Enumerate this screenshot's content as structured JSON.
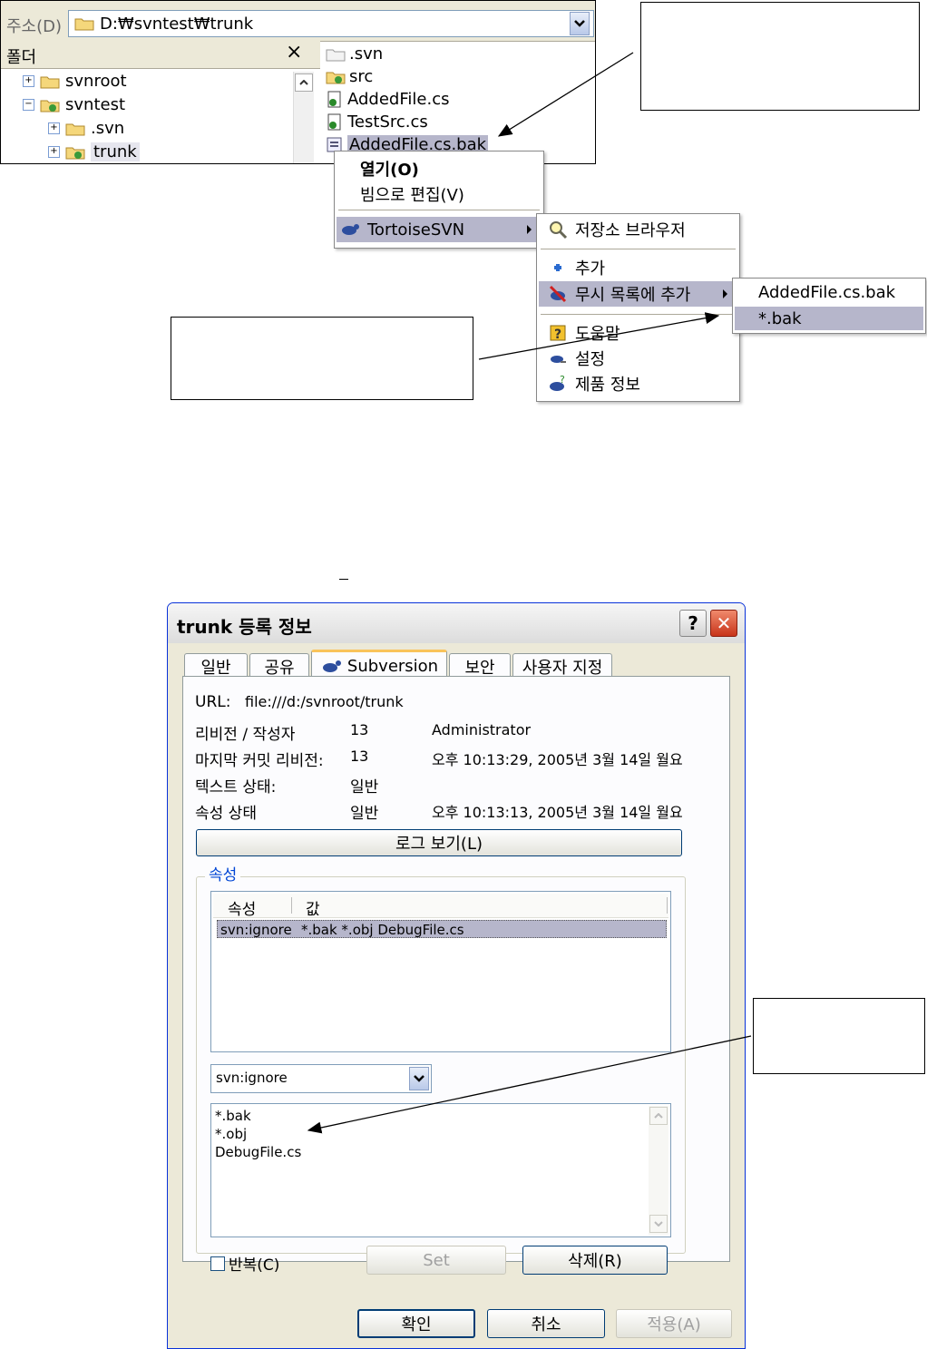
{
  "explorer": {
    "address_label": "주소(D)",
    "address_value": "D:₩svntest₩trunk",
    "folders_label": "폴더",
    "close_glyph": "×",
    "tree": [
      {
        "label": "svnroot",
        "expander": "+"
      },
      {
        "label": "svntest",
        "expander": "−"
      },
      {
        "label": ".svn",
        "expander": "+"
      },
      {
        "label": "trunk",
        "expander": "+"
      }
    ],
    "files": [
      ".svn",
      "src",
      "AddedFile.cs",
      "TestSrc.cs",
      "AddedFile.cs.bak"
    ]
  },
  "context_menu": {
    "open": "열기(O)",
    "edit_vim": "빔으로 편집(V)",
    "tortoise": "TortoiseSVN"
  },
  "tortoise_menu": {
    "repo_browser": "저장소 브라우저",
    "add": "추가",
    "add_ignore": "무시 목록에 추가",
    "help": "도움말",
    "settings": "설정",
    "about": "제품 정보"
  },
  "ignore_submenu": {
    "file": "AddedFile.cs.bak",
    "pattern": "*.bak"
  },
  "dialog": {
    "title": "trunk 등록 정보",
    "help_glyph": "?",
    "close_glyph": "✕",
    "tabs": [
      "일반",
      "공유",
      "Subversion",
      "보안",
      "사용자 지정"
    ],
    "url_label": "URL:",
    "url_value": "file:///d:/svnroot/trunk",
    "rows": [
      {
        "label": "리비전 / 작성자",
        "v1": "13",
        "v2": "Administrator"
      },
      {
        "label": "마지막 커밋 리비전:",
        "v1": "13",
        "v2": "오후 10:13:29, 2005년 3월 14일 월요"
      },
      {
        "label": "텍스트 상태:",
        "v1": "일반",
        "v2": ""
      },
      {
        "label": "속성 상태",
        "v1": "일반",
        "v2": "오후 10:13:13, 2005년 3월 14일 월요"
      }
    ],
    "log_button": "로그 보기(L)",
    "props_group": "속성",
    "col_prop": "속성",
    "col_value": "값",
    "prop_row": {
      "name": "svn:ignore",
      "value": "*.bak *.obj DebugFile.cs"
    },
    "combo_value": "svn:ignore",
    "value_lines": [
      "*.bak",
      "*.obj",
      "DebugFile.cs"
    ],
    "recursive_label": "반복(C)",
    "set_button": "Set",
    "delete_button": "삭제(R)",
    "ok_button": "확인",
    "cancel_button": "취소",
    "apply_button": "적용(A)"
  },
  "colors": {
    "selection": "#b6b6cb",
    "dialog_bg": "#ece9d8",
    "tab_active_top": "#f9c35a",
    "close_red": "#e0482a"
  }
}
